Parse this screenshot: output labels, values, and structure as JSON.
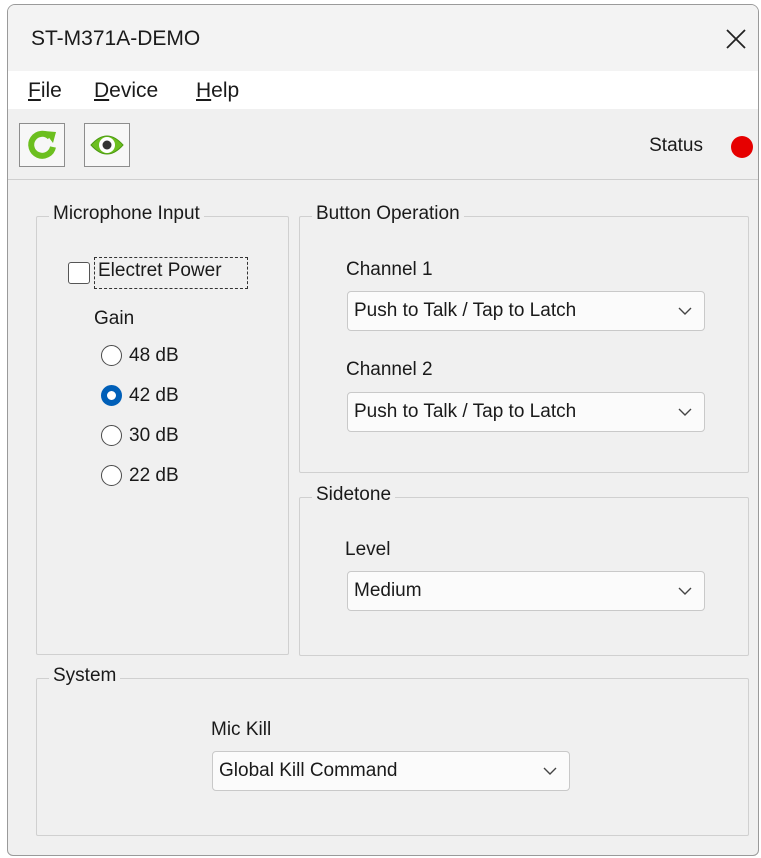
{
  "window": {
    "title": "ST-M371A-DEMO"
  },
  "menu": [
    {
      "label": "File",
      "accel": "F",
      "rest": "ile"
    },
    {
      "label": "Device",
      "accel": "D",
      "rest": "evice"
    },
    {
      "label": "Help",
      "accel": "H",
      "rest": "elp"
    }
  ],
  "toolbar": {
    "refresh_icon": "refresh-icon",
    "view_icon": "eye-icon",
    "status_label": "Status",
    "status_color": "#e60000"
  },
  "microphone_input": {
    "title": "Microphone Input",
    "electret_power": {
      "label": "Electret Power",
      "checked": false
    },
    "gain_label": "Gain",
    "gain_options": [
      "48 dB",
      "42 dB",
      "30 dB",
      "22 dB"
    ],
    "gain_selected": "42 dB"
  },
  "button_operation": {
    "title": "Button Operation",
    "channel1_label": "Channel 1",
    "channel1_value": "Push to Talk / Tap to Latch",
    "channel2_label": "Channel 2",
    "channel2_value": "Push to Talk / Tap to Latch"
  },
  "sidetone": {
    "title": "Sidetone",
    "level_label": "Level",
    "level_value": "Medium"
  },
  "system": {
    "title": "System",
    "mic_kill_label": "Mic Kill",
    "mic_kill_value": "Global Kill Command"
  },
  "colors": {
    "accent": "#005fb8",
    "icon_green": "#6cbf1f"
  }
}
